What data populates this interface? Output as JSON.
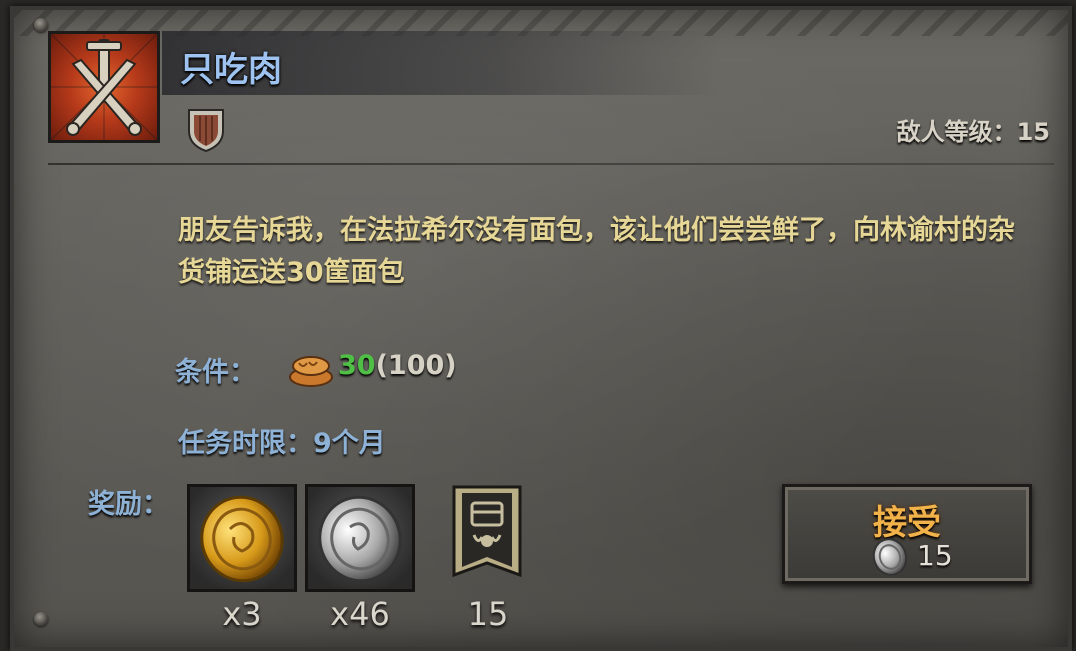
{
  "quest": {
    "title": "只吃肉",
    "icon": "crossed-swords-icon",
    "type_icon": "shield-icon",
    "enemy_level_label": "敌人等级：15",
    "description": "朋友告诉我，在法拉希尔没有面包，该让他们尝尝鲜了，向林谕村的杂货铺运送30筐面包",
    "condition": {
      "label": "条件：",
      "icon": "bread-icon",
      "current": "30",
      "total": "(100)"
    },
    "time_limit": "任务时限：9个月"
  },
  "rewards": {
    "label": "奖励：",
    "items": [
      {
        "icon": "gold-coin-icon",
        "count": "x3"
      },
      {
        "icon": "silver-coin-icon",
        "count": "x46"
      },
      {
        "icon": "faction-banner-icon",
        "count": "15"
      }
    ]
  },
  "accept": {
    "label": "接受",
    "cost_icon": "silver-coin-icon",
    "cost": "15"
  },
  "colors": {
    "title": "#9ec3f0",
    "description": "#e6d796",
    "label": "#8eb1d6",
    "condition_current": "#4fbf45",
    "accept": "#f2b24a"
  }
}
